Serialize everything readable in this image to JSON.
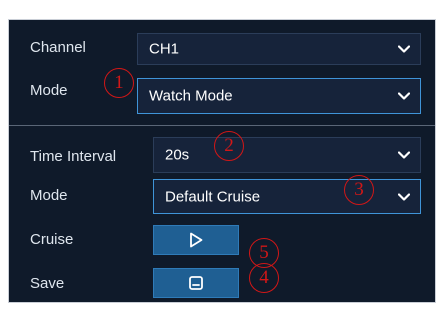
{
  "fields": {
    "channel": {
      "label": "Channel",
      "value": "CH1"
    },
    "mode1": {
      "label": "Mode",
      "value": "Watch Mode"
    },
    "time_interval": {
      "label": "Time Interval",
      "value": "20s"
    },
    "mode2": {
      "label": "Mode",
      "value": "Default Cruise"
    }
  },
  "actions": {
    "cruise": {
      "label": "Cruise",
      "icon": "play-icon"
    },
    "save": {
      "label": "Save",
      "icon": "save-icon"
    }
  },
  "annotations": [
    "1",
    "2",
    "3",
    "4",
    "5"
  ],
  "colors": {
    "panel_bg": "#0f1a2a",
    "field_bg": "#16233a",
    "active_border": "#3f94d8",
    "button_bg": "#1f5f93",
    "annotation": "#d11717"
  }
}
